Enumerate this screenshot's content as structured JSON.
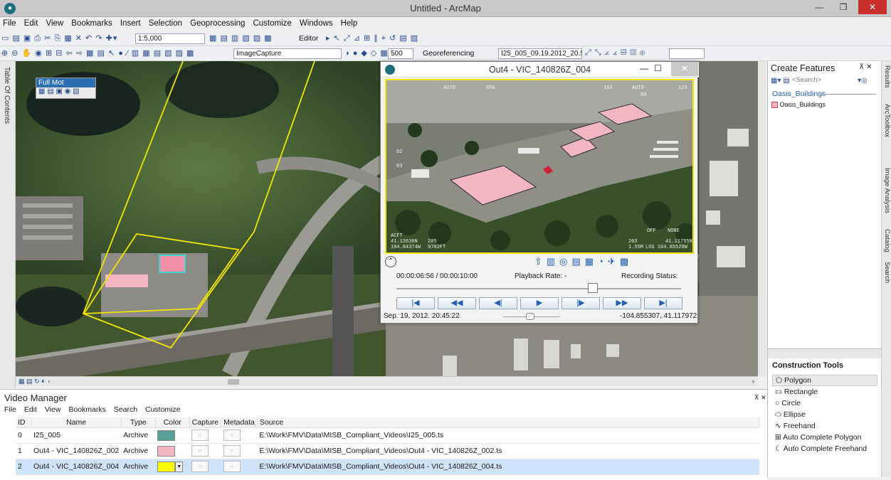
{
  "window": {
    "title": "Untitled - ArcMap",
    "icon": "globe-icon"
  },
  "menubar": [
    "File",
    "Edit",
    "View",
    "Bookmarks",
    "Insert",
    "Selection",
    "Geoprocessing",
    "Customize",
    "Windows",
    "Help"
  ],
  "toolbar1": {
    "scale": "1:5,000",
    "editor_label": "Editor"
  },
  "toolbar2": {
    "layer_combo": "ImageCapture",
    "zoom_combo": "500",
    "georef_label": "Georeferencing",
    "georef_combo": "I25_005_09.19.2012_20.50"
  },
  "toc": {
    "label": "Table Of Contents"
  },
  "fmv_mini": {
    "title": "Full Mot"
  },
  "video_window": {
    "title": "Out4 - VIC_140826Z_004",
    "time": "00:00:06:56 / 00:00:10:00",
    "playback_rate": "Playback Rate: -",
    "recording_status": "Recording Status:",
    "datetime": "Sep. 19, 2012. 20:45:22",
    "coords": "-104.855307, 41.117972",
    "hud": {
      "tl": "AUTO",
      "tc": "SPA",
      "tr1": "163",
      "tr2": "AUTO",
      "tr3": "123",
      "l1": "02",
      "l2": "03",
      "bl1": "ACFT",
      "bl2": "41.13630N",
      "bl3": "104.84374W",
      "bm1": "205",
      "bm2": "9702FT",
      "br1": "OFF",
      "br2": "NONE",
      "br3": "203",
      "br4": "1.55M",
      "br5": "41.11755N",
      "br6": "LOS 104.85529W",
      "pct": "60"
    }
  },
  "right_panel": {
    "title": "Create Features",
    "search_placeholder": "<Search>",
    "group": "Oasis_Buildings",
    "template": "Oasis_Buildings",
    "tools_title": "Construction Tools",
    "tools": [
      "Polygon",
      "Rectangle",
      "Circle",
      "Ellipse",
      "Freehand",
      "Auto Complete Polygon",
      "Auto Complete Freehand"
    ]
  },
  "side_tabs": [
    "Results",
    "ArcToolbox",
    "Image Analysis",
    "Catalog",
    "Search"
  ],
  "video_manager": {
    "title": "Video Manager",
    "menus": [
      "File",
      "Edit",
      "View",
      "Bookmarks",
      "Search",
      "Customize"
    ],
    "columns": [
      "ID",
      "Name",
      "Type",
      "Color",
      "Capture",
      "Metadata",
      "Source"
    ],
    "rows": [
      {
        "id": "0",
        "name": "I25_005",
        "type": "Archive",
        "color": "#5a9e9a",
        "source": "E:\\Work\\FMV\\Data\\MISB_Compliant_Videos\\I25_005.ts"
      },
      {
        "id": "1",
        "name": "Out4 - VIC_140826Z_002",
        "type": "Archive",
        "color": "#f4b6c2",
        "source": "E:\\Work\\FMV\\Data\\MISB_Compliant_Videos\\Out4 - VIC_140826Z_002.ts"
      },
      {
        "id": "2",
        "name": "Out4 - VIC_140826Z_004",
        "type": "Archive",
        "color": "#ffff00",
        "source": "E:\\Work\\FMV\\Data\\MISB_Compliant_Videos\\Out4 - VIC_140826Z_004.ts"
      }
    ]
  },
  "playback_progress": 0.69
}
